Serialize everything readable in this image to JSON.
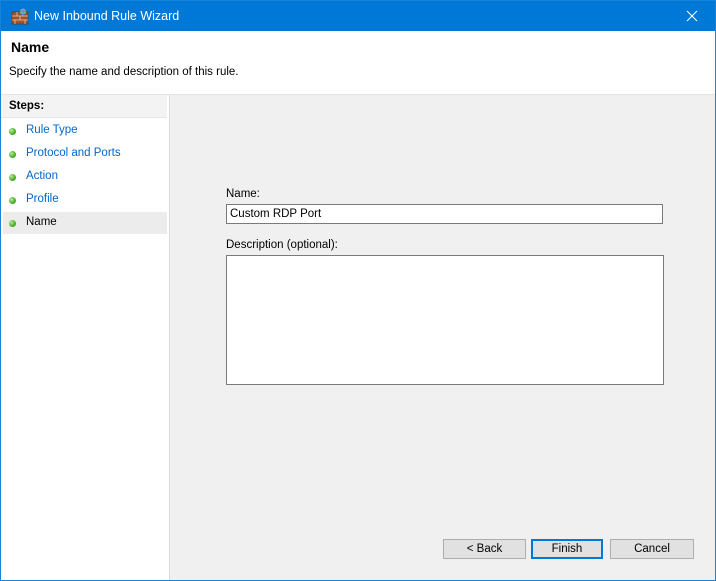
{
  "window": {
    "title": "New Inbound Rule Wizard",
    "app_icon": "firewall-icon",
    "close_icon": "close-icon"
  },
  "header": {
    "title": "Name",
    "subtitle": "Specify the name and description of this rule."
  },
  "steps": {
    "title": "Steps:",
    "items": [
      {
        "label": "Rule Type"
      },
      {
        "label": "Protocol and Ports"
      },
      {
        "label": "Action"
      },
      {
        "label": "Profile"
      },
      {
        "label": "Name"
      }
    ],
    "active_index": 4
  },
  "form": {
    "name_label": "Name:",
    "name_value": "Custom RDP Port",
    "description_label": "Description (optional):",
    "description_value": ""
  },
  "buttons": {
    "back": "< Back",
    "finish": "Finish",
    "cancel": "Cancel"
  },
  "colors": {
    "titlebar": "#0078d7",
    "link": "#0066cc",
    "content_bg": "#f0f0f0",
    "step_dot": "#4fb32b"
  }
}
